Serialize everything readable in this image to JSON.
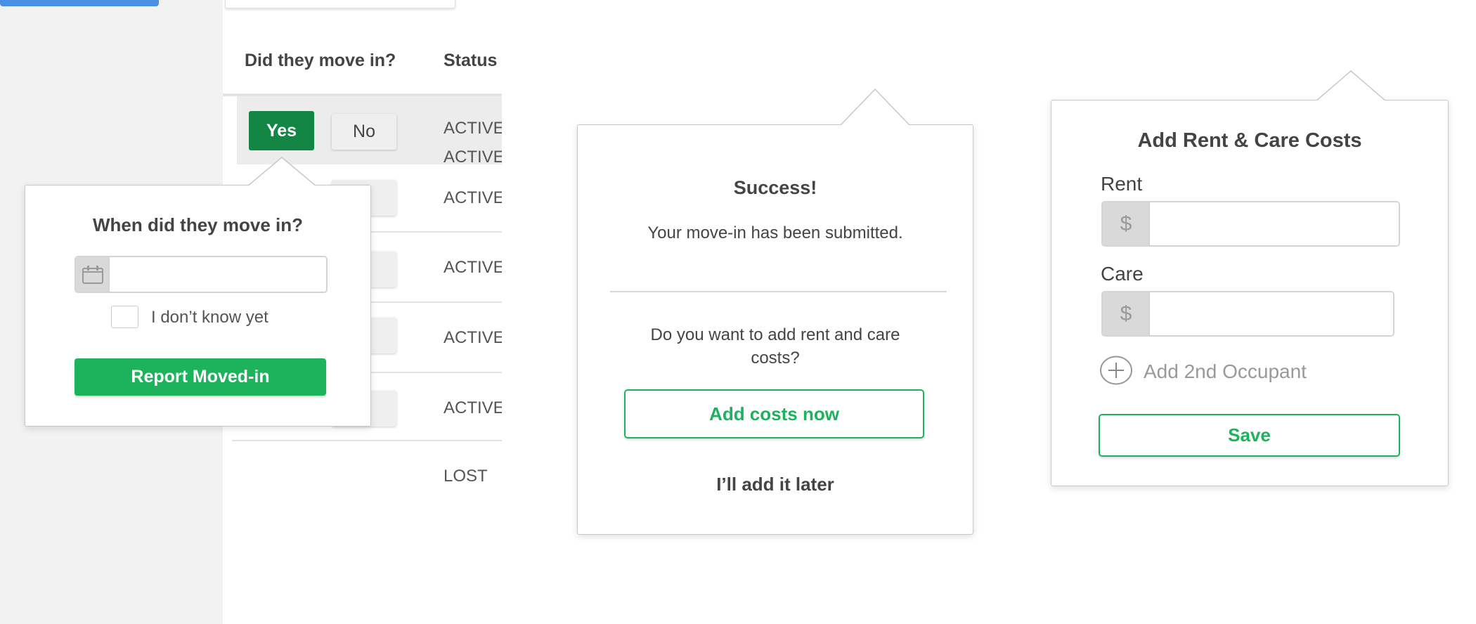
{
  "table": {
    "headers": [
      "Did they move in?",
      "Status"
    ],
    "yes_label": "Yes",
    "no_label": "No",
    "statuses": [
      "ACTIVE",
      "ACTIVE",
      "ACTIVE",
      "ACTIVE",
      "ACTIVE",
      "LOST"
    ]
  },
  "move_in_popover": {
    "title": "When did they move in?",
    "date_placeholder": "",
    "date_icon": "calendar-icon",
    "checkbox_label": "I don’t know yet",
    "checked": false,
    "submit_label": "Report Moved-in"
  },
  "success_popover": {
    "title": "Success!",
    "message": "Your move-in has been submitted.",
    "question": "Do you want to add rent and care costs?",
    "primary_label": "Add costs now",
    "secondary_label": "I’ll add it later"
  },
  "costs_popover": {
    "title": "Add Rent & Care Costs",
    "rent_label": "Rent",
    "care_label": "Care",
    "currency": "$",
    "rent_value": "",
    "care_value": "",
    "add_occupant_label": "Add 2nd Occupant",
    "save_label": "Save"
  },
  "colors": {
    "green": "#1db35c",
    "dark_green": "#138545",
    "blue": "#4a90e2"
  }
}
